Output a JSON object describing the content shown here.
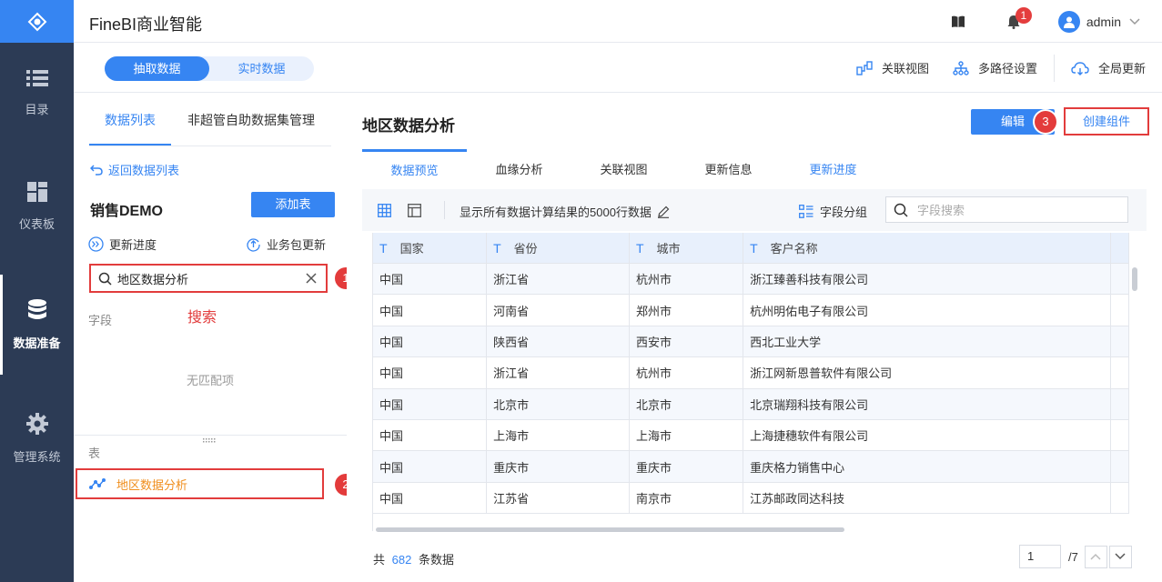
{
  "nav": {
    "items": [
      {
        "label": "目录",
        "icon": "list-icon"
      },
      {
        "label": "仪表板",
        "icon": "dashboard-icon"
      },
      {
        "label": "数据准备",
        "icon": "database-icon"
      },
      {
        "label": "管理系统",
        "icon": "gear-icon"
      }
    ]
  },
  "header": {
    "title": "FineBI商业智能",
    "notification_count": "1",
    "user": "admin"
  },
  "subbar": {
    "toggle": [
      "抽取数据",
      "实时数据"
    ],
    "actions": [
      "关联视图",
      "多路径设置",
      "全局更新"
    ]
  },
  "left": {
    "tabs": [
      "数据列表",
      "非超管自助数据集管理"
    ],
    "back": "返回数据列表",
    "package": "销售DEMO",
    "add_table": "添加表",
    "update_progress": "更新进度",
    "package_update": "业务包更新",
    "search_value": "地区数据分析",
    "field_label": "字段",
    "search_note": "搜索",
    "no_match": "无匹配项",
    "table_label": "表",
    "table_item": "地区数据分析",
    "markers": [
      "1",
      "2"
    ]
  },
  "main": {
    "title": "地区数据分析",
    "edit": "编辑",
    "create": "创建组件",
    "marker": "3",
    "tabs": [
      "数据预览",
      "血缘分析",
      "关联视图",
      "更新信息",
      "更新进度"
    ],
    "info": "显示所有数据计算结果的5000行数据",
    "field_group": "字段分组",
    "field_search_placeholder": "字段搜索",
    "columns": [
      "国家",
      "省份",
      "城市",
      "客户名称"
    ],
    "col_type": "T",
    "rows": [
      [
        "中国",
        "浙江省",
        "杭州市",
        "浙江臻善科技有限公司"
      ],
      [
        "中国",
        "河南省",
        "郑州市",
        "杭州明佑电子有限公司"
      ],
      [
        "中国",
        "陕西省",
        "西安市",
        "西北工业大学"
      ],
      [
        "中国",
        "浙江省",
        "杭州市",
        "浙江网新恩普软件有限公司"
      ],
      [
        "中国",
        "北京市",
        "北京市",
        "北京瑞翔科技有限公司"
      ],
      [
        "中国",
        "上海市",
        "上海市",
        "上海捷穗软件有限公司"
      ],
      [
        "中国",
        "重庆市",
        "重庆市",
        "重庆格力销售中心"
      ],
      [
        "中国",
        "江苏省",
        "南京市",
        "江苏邮政同达科技"
      ]
    ],
    "footer_prefix": "共",
    "footer_count": "682",
    "footer_suffix": "条数据",
    "page_current": "1",
    "page_total": "/7"
  }
}
